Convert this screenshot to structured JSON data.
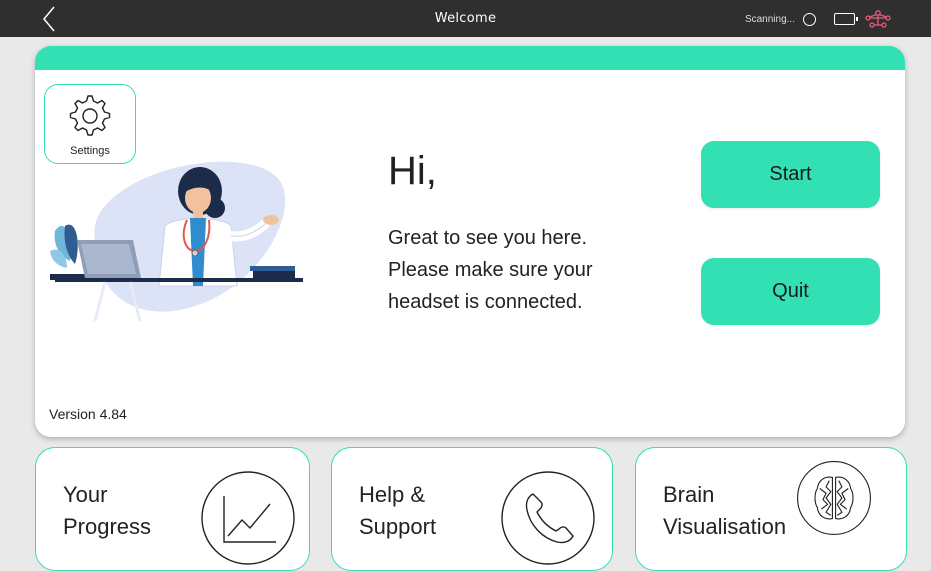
{
  "topbar": {
    "title": "Welcome",
    "scan_status": "Scanning...",
    "icons": [
      "back-icon",
      "scan-circle-icon",
      "battery-icon",
      "headset-network-icon"
    ]
  },
  "card": {
    "settings_label": "Settings",
    "greeting": "Hi,",
    "message_lines": [
      "Great to see you here.",
      "Please make sure your",
      "headset is connected."
    ],
    "start_label": "Start",
    "quit_label": "Quit",
    "version": "Version 4.84"
  },
  "tiles": [
    {
      "line1": "Your",
      "line2": "Progress",
      "icon": "progress-chart-icon"
    },
    {
      "line1": "Help &",
      "line2": "Support",
      "icon": "phone-icon"
    },
    {
      "line1": "Brain",
      "line2": "Visualisation",
      "icon": "brain-icon"
    }
  ],
  "colors": {
    "accent": "#33e0b3",
    "topbar": "#2f2f2f",
    "background": "#e9e9e9",
    "network_icon": "#e85a7a"
  }
}
